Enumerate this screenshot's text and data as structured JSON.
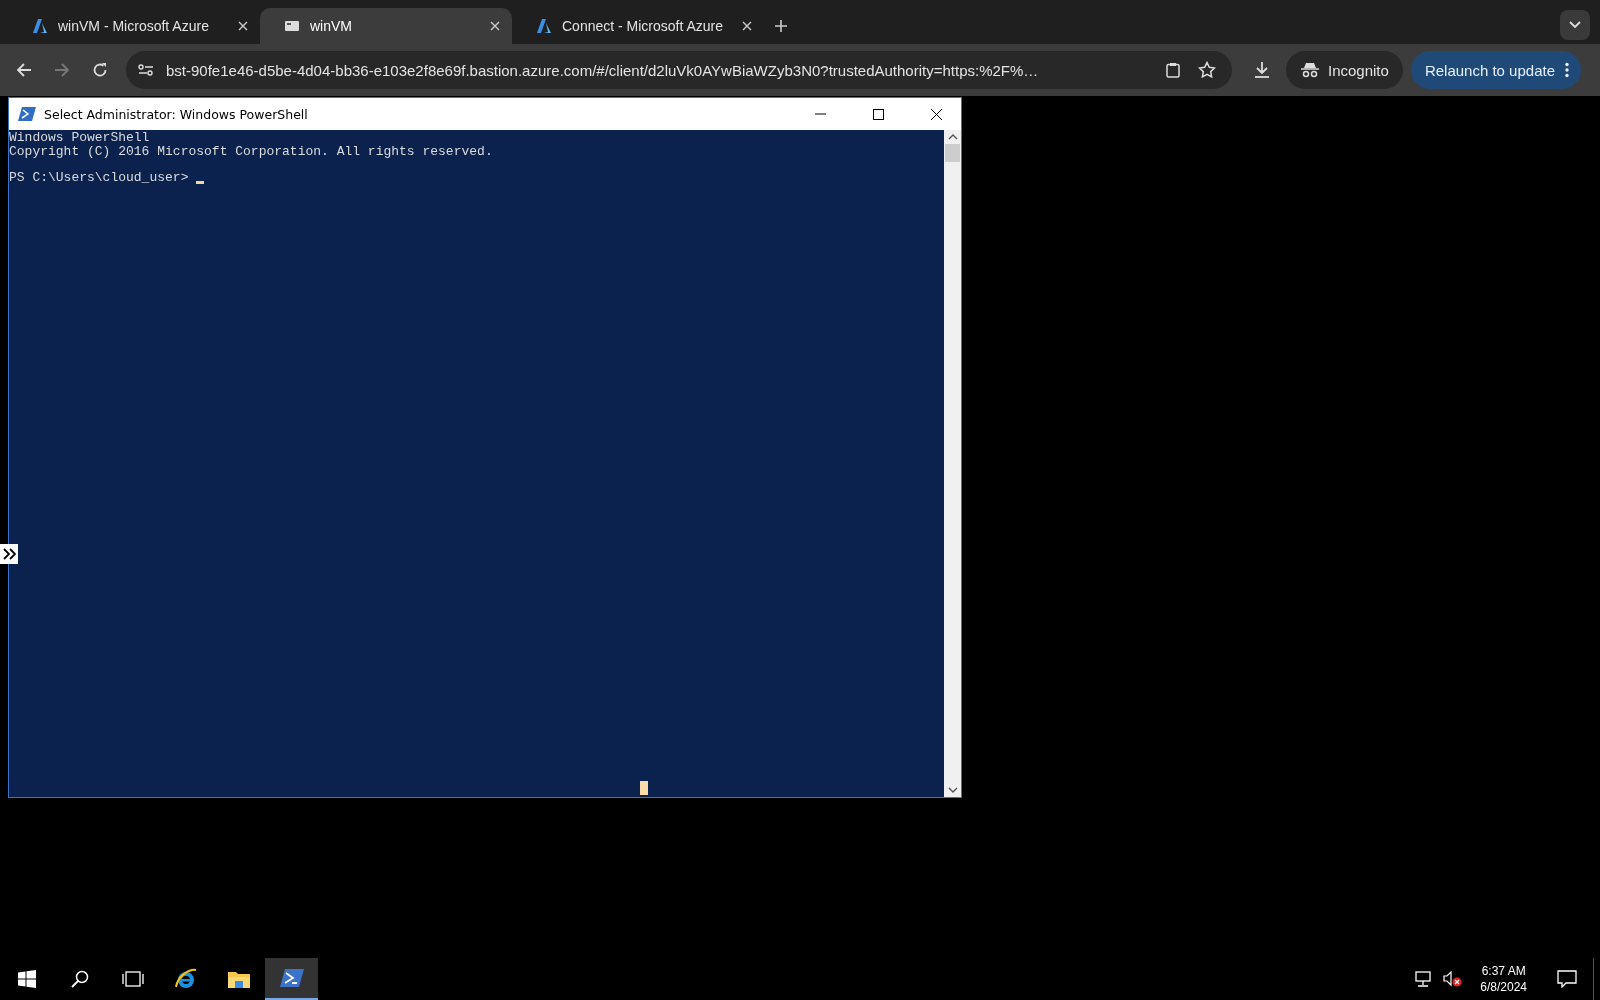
{
  "browser": {
    "tabs": [
      {
        "title": "winVM - Microsoft Azure",
        "kind": "azure",
        "selected": false
      },
      {
        "title": "winVM",
        "kind": "page",
        "selected": true
      },
      {
        "title": "Connect - Microsoft Azure",
        "kind": "azure",
        "selected": false
      }
    ],
    "address": "bst-90fe1e46-d5be-4d04-bb36-e103e2f8e69f.bastion.azure.com/#/client/d2luVk0AYwBiaWZyb3N0?trustedAuthority=https:%2F%…",
    "profile": "Incognito",
    "update_button": "Relaunch to update"
  },
  "window": {
    "title": "Select Administrator: Windows PowerShell",
    "lines": [
      "Windows PowerShell",
      "Copyright (C) 2016 Microsoft Corporation. All rights reserved."
    ],
    "prompt": "PS C:\\Users\\cloud_user> "
  },
  "taskbar": {
    "apps": [
      {
        "kind": "start",
        "selected": false
      },
      {
        "kind": "search",
        "selected": false
      },
      {
        "kind": "taskview",
        "selected": false
      },
      {
        "kind": "ie",
        "selected": false
      },
      {
        "kind": "explorer",
        "selected": false
      },
      {
        "kind": "powershell",
        "selected": true
      }
    ],
    "time": "6:37 AM",
    "date": "6/8/2024"
  }
}
